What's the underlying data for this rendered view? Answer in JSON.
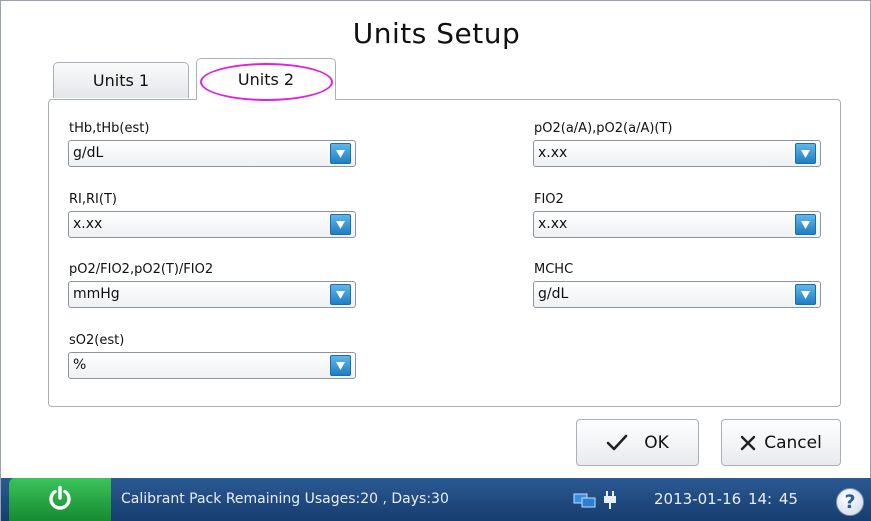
{
  "window": {
    "title": "Units Setup"
  },
  "tabs": [
    {
      "label": "Units 1",
      "active": false
    },
    {
      "label": "Units 2",
      "active": true
    }
  ],
  "fields": {
    "thb": {
      "label": "tHb,tHb(est)",
      "value": "g/dL"
    },
    "ri": {
      "label": "RI,RI(T)",
      "value": "x.xx"
    },
    "po2fio2": {
      "label": "pO2/FIO2,pO2(T)/FIO2",
      "value": "mmHg"
    },
    "so2est": {
      "label": "sO2(est)",
      "value": "%"
    },
    "po2aa": {
      "label": "pO2(a/A),pO2(a/A)(T)",
      "value": "x.xx"
    },
    "fio2": {
      "label": "FIO2",
      "value": "x.xx"
    },
    "mchc": {
      "label": "MCHC",
      "value": "g/dL"
    }
  },
  "buttons": {
    "ok": "OK",
    "cancel": "Cancel"
  },
  "statusbar": {
    "message": "Calibrant Pack Remaining Usages:20 , Days:30",
    "datetime": "2013-01-16  14: 45",
    "help": "?"
  },
  "icons": {
    "power": "power-icon",
    "network": "network-icon",
    "plug": "plug-icon",
    "dropdown": "dropdown-arrow-icon",
    "ok": "checkmark-icon",
    "cancel": "x-icon",
    "help": "help-icon"
  },
  "colors": {
    "accent_blue": "#2a8ad4",
    "statusbar": "#1e4a80",
    "power_green": "#23a640",
    "tab_highlight": "#e020e0"
  }
}
